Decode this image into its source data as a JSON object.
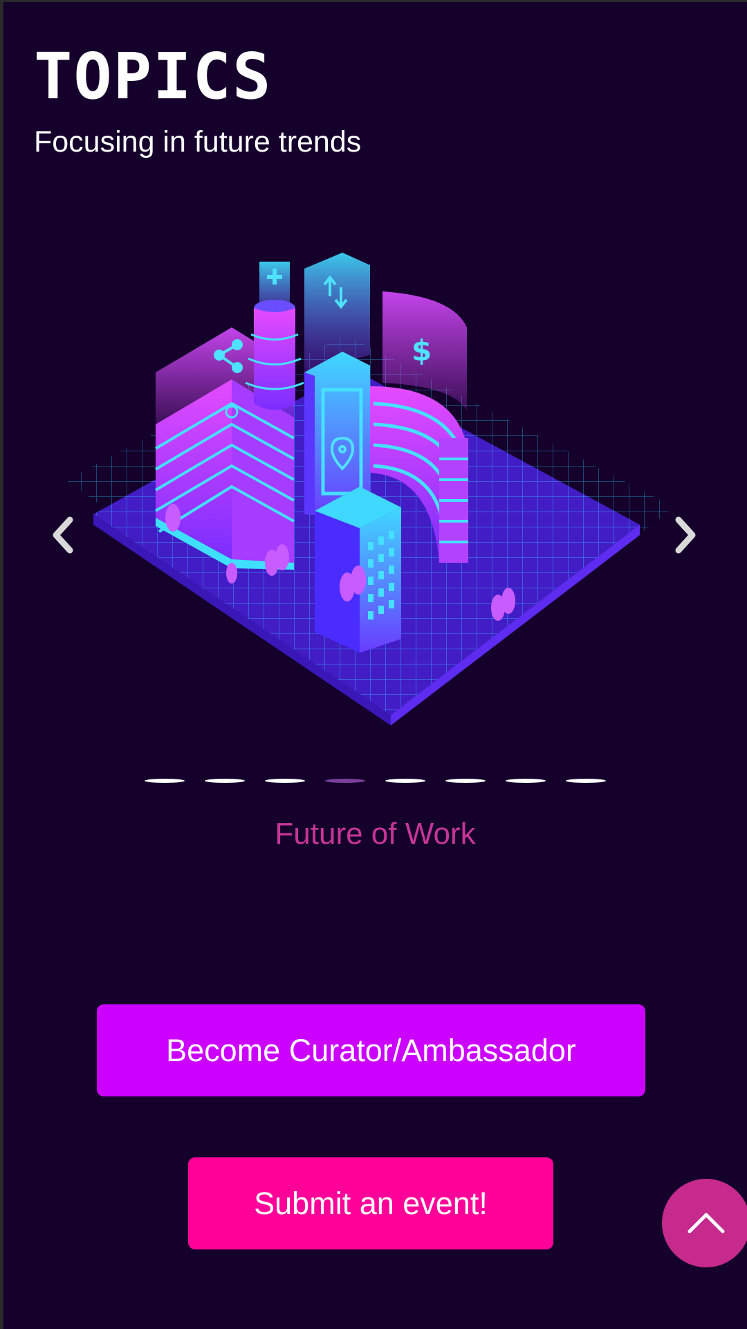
{
  "header": {
    "title": "TOPICS",
    "subtitle": "Focusing in future trends"
  },
  "carousel": {
    "slide_count": 8,
    "active_index": 3,
    "caption": "Future of Work",
    "prev_icon": "chevron-left-icon",
    "next_icon": "chevron-right-icon",
    "illustration_icons": [
      "share-icon",
      "plus-icon",
      "transfer-arrows-icon",
      "dollar-icon",
      "location-pin-icon"
    ]
  },
  "actions": {
    "curator_label": "Become Curator/Ambassador",
    "submit_label": "Submit an event!"
  },
  "scroll_top": {
    "icon": "chevron-up-icon"
  },
  "colors": {
    "background": "#14002b",
    "curator_button": "#cc00ff",
    "submit_button": "#ff0099",
    "scroll_top_button": "#c62a8c",
    "caption": "#c73597",
    "active_dot": "#7b3f9e"
  }
}
